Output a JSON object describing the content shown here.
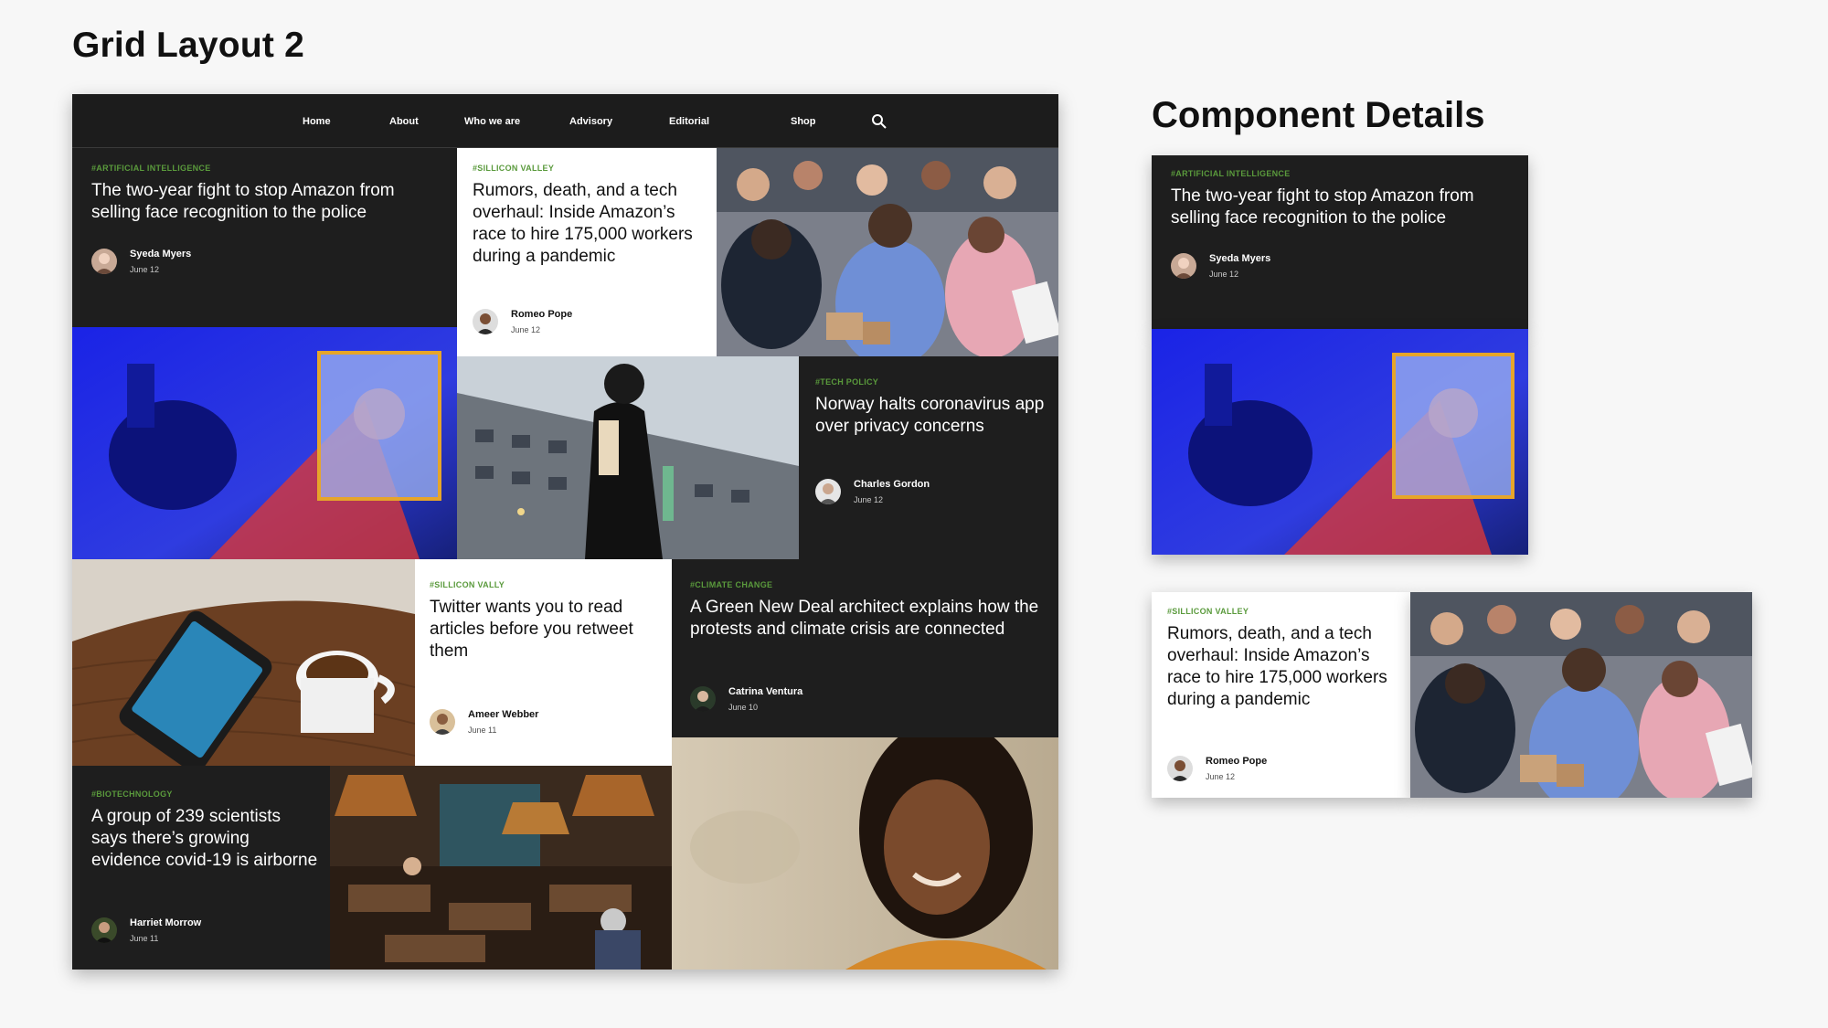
{
  "page": {
    "title": "Grid Layout 2",
    "details_title": "Component Details"
  },
  "nav": {
    "items": [
      "Home",
      "About",
      "Who we are",
      "Advisory",
      "Editorial",
      "Shop"
    ],
    "search_icon": "search-icon"
  },
  "articles": {
    "amazon_police": {
      "tag": "#ARTIFICIAL INTELLIGENCE",
      "headline": "The two-year fight to stop Amazon from selling face recognition to the police",
      "author": "Syeda Myers",
      "date": "June 12"
    },
    "amazon_hire": {
      "tag": "#SILLICON VALLEY",
      "headline": "Rumors, death, and a tech overhaul: Inside Amazon’s race to hire 175,000 workers during a pandemic",
      "author": "Romeo Pope",
      "date": "June 12"
    },
    "norway": {
      "tag": "#TECH POLICY",
      "headline": "Norway halts coronavirus app over privacy concerns",
      "author": "Charles Gordon",
      "date": "June 12"
    },
    "twitter": {
      "tag": "#SILLICON VALLY",
      "headline": "Twitter wants you to read articles before you retweet them",
      "author": "Ameer Webber",
      "date": "June 11"
    },
    "green_deal": {
      "tag": "#CLIMATE CHANGE",
      "headline": "A Green New Deal architect explains how the protests and climate crisis are connected",
      "author": "Catrina Ventura",
      "date": "June 10"
    },
    "covid_airborne": {
      "tag": "#BIOTECHNOLOGY",
      "headline": "A group of 239 scientists says there’s growing evidence covid-19 is airborne",
      "author": "Harriet Morrow",
      "date": "June 11"
    }
  },
  "colors": {
    "accent_tag": "#5a9a3c",
    "dark_card": "#1e1e1e",
    "light_card": "#ffffff",
    "highlight_frame": "#e6a52a"
  }
}
